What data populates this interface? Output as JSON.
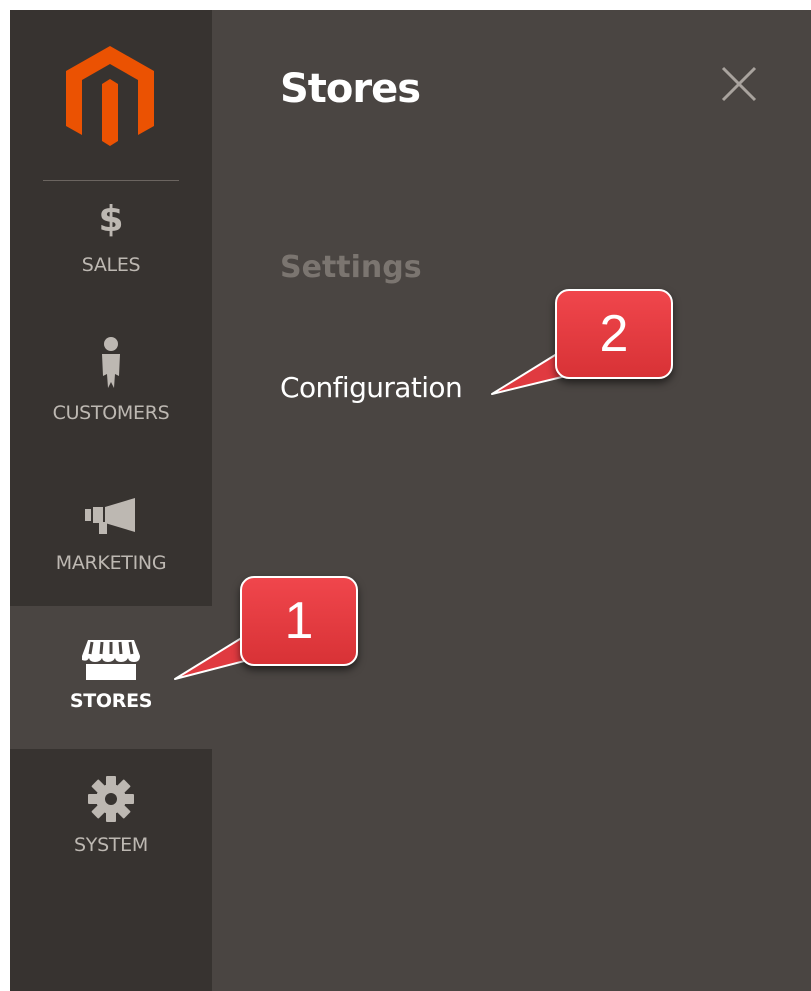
{
  "sidebar": {
    "items": [
      {
        "id": "sales",
        "label": "SALES",
        "icon": "dollar-icon",
        "glyph": "$",
        "active": false
      },
      {
        "id": "customers",
        "label": "CUSTOMERS",
        "icon": "person-icon",
        "active": false
      },
      {
        "id": "marketing",
        "label": "MARKETING",
        "icon": "megaphone-icon",
        "active": false
      },
      {
        "id": "stores",
        "label": "STORES",
        "icon": "storefront-icon",
        "active": true
      },
      {
        "id": "system",
        "label": "SYSTEM",
        "icon": "gear-icon",
        "active": false
      }
    ]
  },
  "panel": {
    "title": "Stores",
    "section_heading": "Settings",
    "link_label": "Configuration",
    "close_icon": "close-icon"
  },
  "callouts": {
    "one": "1",
    "two": "2"
  },
  "colors": {
    "sidebar_bg": "#373330",
    "panel_bg": "#4a4542",
    "logo_orange": "#eb5202",
    "callout_red": "#e83e44"
  }
}
